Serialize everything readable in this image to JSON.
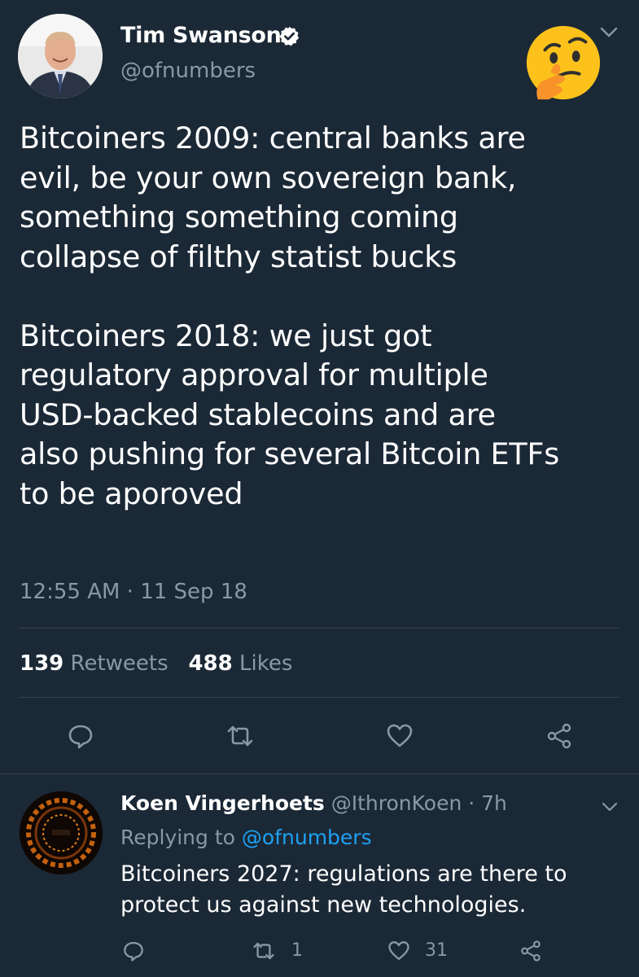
{
  "tweet": {
    "author_name": "Tim Swanson",
    "author_handle": "@ofnumbers",
    "text": "Bitcoiners 2009: central banks are\nevil, be your own sovereign bank,\nsomething something coming\ncollapse of filthy statist bucks\n\nBitcoiners 2018: we just got\nregulatory approval for multiple\nUSD-backed stablecoins and are\nalso pushing for several Bitcoin ETFs\nto be aporoved",
    "timestamp": "12:55 AM · 11 Sep 18",
    "retweets_count": "139",
    "retweets_label": "Retweets",
    "likes_count": "488",
    "likes_label": "Likes",
    "icons": [
      "verified-badge-icon",
      "thinking-face-emoji",
      "chevron-down-icon",
      "reply-icon",
      "retweet-icon",
      "like-icon",
      "share-icon"
    ]
  },
  "reply": {
    "author_name": "Koen Vingerhoets",
    "author_handle": "@IthronKoen",
    "age": "· 7h",
    "replying_prefix": "Replying to",
    "replying_to": "@ofnumbers",
    "text": "Bitcoiners 2027: regulations are there to\nprotect us against new technologies.",
    "retweet_count": "1",
    "like_count": "31"
  },
  "colors": {
    "background": "#1b2836",
    "muted": "#8899a6",
    "link": "#1da1f2",
    "divider": "#38444d"
  }
}
